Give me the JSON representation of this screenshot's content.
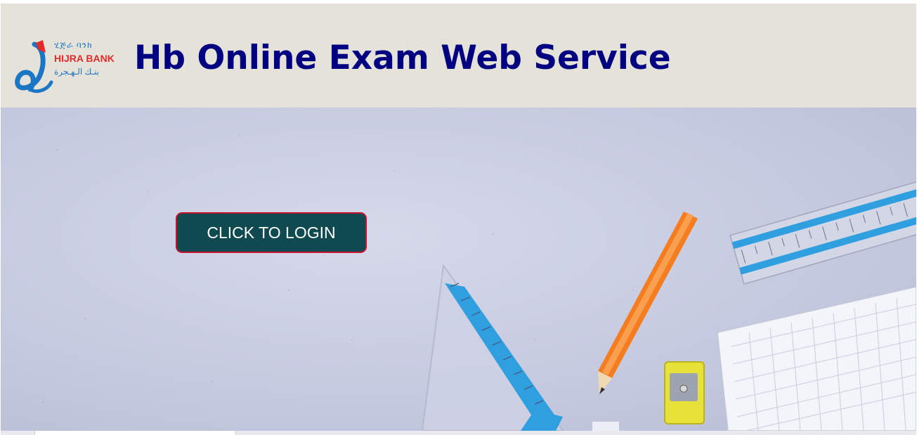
{
  "header": {
    "logo": {
      "amharic_text": "ሂጅራ ባንክ",
      "name_text": "HIJRA BANK",
      "arabic_text": "بنـك الـهـجرة",
      "icon": "hijra-bank-logo"
    },
    "title": "Hb Online Exam Web Service",
    "background_color": "#e5e3d9",
    "title_color": "#000080"
  },
  "hero": {
    "login_button_label": "CLICK TO LOGIN",
    "button_color": "#0f4a50",
    "button_border_color": "#c6122a",
    "image_description_icons": [
      "ruler-icon",
      "pencil-icon",
      "set-square-icon",
      "sharpener-icon",
      "graph-paper-icon"
    ]
  }
}
